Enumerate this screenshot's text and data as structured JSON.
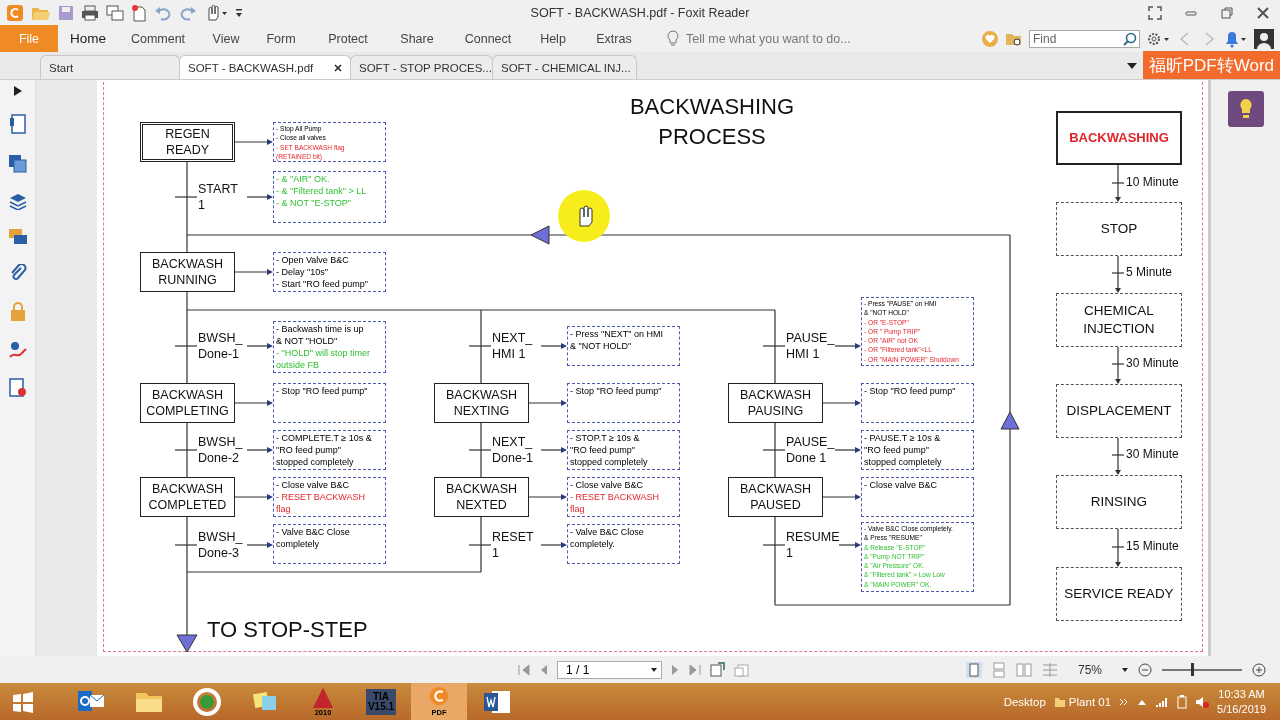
{
  "window": {
    "title": "SOFT - BACKWASH.pdf - Foxit Reader"
  },
  "ribbon": {
    "file_button": "File",
    "tabs": [
      {
        "label": "Home",
        "kind": "tab",
        "selected": true
      },
      {
        "label": "Comment",
        "kind": "tab",
        "selected": false
      },
      {
        "label": "View",
        "kind": "tab",
        "selected": false
      },
      {
        "label": "Form",
        "kind": "tab",
        "selected": false
      },
      {
        "label": "Protect",
        "kind": "tab",
        "selected": false
      },
      {
        "label": "Share",
        "kind": "tab",
        "selected": false
      },
      {
        "label": "Connect",
        "kind": "tab",
        "selected": false
      },
      {
        "label": "Help",
        "kind": "tab",
        "selected": false
      },
      {
        "label": "Extras",
        "kind": "tab",
        "selected": false
      }
    ],
    "tell_me": {
      "placeholder": "Tell me what you want to do..."
    },
    "find": {
      "placeholder": "Find"
    }
  },
  "doc_tabs": [
    {
      "label": "Start",
      "selected": false
    },
    {
      "label": "SOFT - BACKWASH.pdf",
      "selected": true
    },
    {
      "label": "SOFT - STOP PROCES...",
      "selected": false
    },
    {
      "label": "SOFT - CHEMICAL INJ...",
      "selected": false
    }
  ],
  "promo": "福昕PDF转Word",
  "diagram": {
    "title": "BACKWASHING\nPROCESS",
    "columns": [
      {
        "items": [
          {
            "kind": "initial",
            "label": "REGEN\nREADY",
            "note": [
              {
                "text": "- Stop All Pump",
                "kind": "normal"
              },
              {
                "text": "- Close all valves",
                "kind": "normal"
              },
              {
                "text": "- SET BACKWASH flag",
                "kind": "critical"
              },
              {
                "text": "(RETAINED bit)",
                "kind": "critical"
              }
            ]
          },
          {
            "kind": "transition",
            "label": "START\n1",
            "note": [
              {
                "text": "- & \"AIR\" OK.",
                "kind": "permissive"
              },
              {
                "text": "- & \"Filtered tank\" > LL",
                "kind": "permissive"
              },
              {
                "text": "- & NOT \"E-STOP\"",
                "kind": "permissive"
              }
            ]
          },
          {
            "kind": "step",
            "label": "BACKWASH\nRUNNING",
            "note": [
              {
                "text": "- Open Valve B&C",
                "kind": "normal"
              },
              {
                "text": "- Delay \"10s\"",
                "kind": "normal"
              },
              {
                "text": "- Start \"RO feed pump\"",
                "kind": "normal"
              }
            ]
          },
          {
            "kind": "transition",
            "label": "BWSH_\nDone-1",
            "note": [
              {
                "text": "- Backwash time is up",
                "kind": "normal"
              },
              {
                "text": "& NOT \"HOLD\"",
                "kind": "normal"
              },
              {
                "text": "- \"HOLD\" will stop timer",
                "kind": "permissive"
              },
              {
                "text": "outside FB",
                "kind": "permissive"
              }
            ]
          },
          {
            "kind": "step",
            "label": "BACKWASH\nCOMPLETING",
            "note": [
              {
                "text": "- Stop \"RO feed pump\"",
                "kind": "normal"
              }
            ]
          },
          {
            "kind": "transition",
            "label": "BWSH_\nDone-2",
            "note": [
              {
                "text": "- COMPLETE.T ≥ 10s &",
                "kind": "normal"
              },
              {
                "text": "\"RO feed pump\"",
                "kind": "normal"
              },
              {
                "text": "stopped completely",
                "kind": "normal"
              }
            ]
          },
          {
            "kind": "step",
            "label": "BACKWASH\nCOMPLETED",
            "note": [
              {
                "text": "- Close valve B&C",
                "kind": "normal"
              },
              {
                "text": "- RESET BACKWASH",
                "kind": "critical"
              },
              {
                "text": "flag",
                "kind": "critical"
              }
            ]
          },
          {
            "kind": "transition",
            "label": "BWSH_\nDone-3",
            "note": [
              {
                "text": "- Valve B&C Close",
                "kind": "normal"
              },
              {
                "text": "completely",
                "kind": "normal"
              }
            ]
          }
        ]
      },
      {
        "items": [
          {
            "kind": "transition",
            "label": "NEXT_\nHMI 1",
            "note": [
              {
                "text": "- Press \"NEXT\" on HMI",
                "kind": "normal"
              },
              {
                "text": "& \"NOT HOLD\"",
                "kind": "normal"
              }
            ]
          },
          {
            "kind": "step",
            "label": "BACKWASH\nNEXTING",
            "note": [
              {
                "text": "- Stop \"RO feed pump\"",
                "kind": "normal"
              }
            ]
          },
          {
            "kind": "transition",
            "label": "NEXT_\nDone-1",
            "note": [
              {
                "text": "- STOP.T ≥ 10s &",
                "kind": "normal"
              },
              {
                "text": "\"RO feed pump\"",
                "kind": "normal"
              },
              {
                "text": "stopped completely",
                "kind": "normal"
              }
            ]
          },
          {
            "kind": "step",
            "label": "BACKWASH\nNEXTED",
            "note": [
              {
                "text": "- Close valve B&C",
                "kind": "normal"
              },
              {
                "text": "- RESET BACKWASH",
                "kind": "critical"
              },
              {
                "text": "flag",
                "kind": "critical"
              }
            ]
          },
          {
            "kind": "transition",
            "label": "RESET\n1",
            "note": [
              {
                "text": "- Valve B&C Close",
                "kind": "normal"
              },
              {
                "text": "completely.",
                "kind": "normal"
              }
            ]
          }
        ]
      },
      {
        "items": [
          {
            "kind": "transition",
            "label": "PAUSE_\nHMI 1",
            "note": [
              {
                "text": "- Press \"PAUSE\" on HMI",
                "kind": "normal"
              },
              {
                "text": "& \"NOT HOLD\"",
                "kind": "normal"
              },
              {
                "text": "- OR \"E-STOP\"",
                "kind": "critical"
              },
              {
                "text": "- OR \" Pump TRIP\"",
                "kind": "critical"
              },
              {
                "text": "- OR \"AIR\" not OK",
                "kind": "critical"
              },
              {
                "text": "- OR \"Filtered tank\"<LL",
                "kind": "critical"
              },
              {
                "text": "- OR \"MAIN POWER\" Shutdown",
                "kind": "critical"
              }
            ]
          },
          {
            "kind": "step",
            "label": "BACKWASH\nPAUSING",
            "note": [
              {
                "text": "- Stop \"RO feed pump\"",
                "kind": "normal"
              }
            ]
          },
          {
            "kind": "transition",
            "label": "PAUSE_\nDone 1",
            "note": [
              {
                "text": "- PAUSE.T ≥ 10s &",
                "kind": "normal"
              },
              {
                "text": "\"RO feed pump\"",
                "kind": "normal"
              },
              {
                "text": "stopped completely",
                "kind": "normal"
              }
            ]
          },
          {
            "kind": "step",
            "label": "BACKWASH\nPAUSED",
            "note": [
              {
                "text": "- Close valve B&C",
                "kind": "normal"
              }
            ]
          },
          {
            "kind": "transition",
            "label": "RESUME\n1",
            "note": [
              {
                "text": "- Valve B&C Close completely.",
                "kind": "normal"
              },
              {
                "text": "& Press \"RESUME\"",
                "kind": "normal"
              },
              {
                "text": "& Release \"E-STOP\"",
                "kind": "permissive"
              },
              {
                "text": "& \"Pump NOT TRIP\"",
                "kind": "permissive"
              },
              {
                "text": "& \"Air Pressure\" OK.",
                "kind": "permissive"
              },
              {
                "text": "& \"Filtered tank\" > Low Low",
                "kind": "permissive"
              },
              {
                "text": "& \"MAIN POWER\" OK.",
                "kind": "permissive"
              }
            ]
          }
        ]
      }
    ],
    "end_label": "TO STOP-STEP",
    "stages": [
      {
        "label": "BACKWASHING",
        "active": true
      },
      {
        "label": "STOP",
        "active": false
      },
      {
        "label": "CHEMICAL\nINJECTION",
        "active": false
      },
      {
        "label": "DISPLACEMENT",
        "active": false
      },
      {
        "label": "RINSING",
        "active": false
      },
      {
        "label": "SERVICE READY",
        "active": false
      }
    ],
    "durations": [
      "10 Minute",
      "5 Minute",
      "30 Minute",
      "30 Minute",
      "15 Minute"
    ]
  },
  "status_bar": {
    "page": "1 / 1",
    "zoom": "75%",
    "zoom_slider": {
      "level": 0.375
    }
  },
  "taskbar": {
    "apps": [
      {
        "kind": "mail",
        "selected": false
      },
      {
        "kind": "folder",
        "selected": false
      },
      {
        "kind": "ring",
        "selected": false
      },
      {
        "kind": "notes",
        "selected": false
      },
      {
        "kind": "cad",
        "label": "2010",
        "selected": false
      },
      {
        "kind": "tia",
        "label": "TIA\nV15.1",
        "selected": false
      },
      {
        "kind": "pdf",
        "label": "PDF",
        "selected": true
      },
      {
        "kind": "word",
        "selected": false
      }
    ],
    "toolbar_label": "Desktop",
    "folder_label": "Plant 01",
    "time": "10:33 AM",
    "date": "5/16/2019"
  }
}
